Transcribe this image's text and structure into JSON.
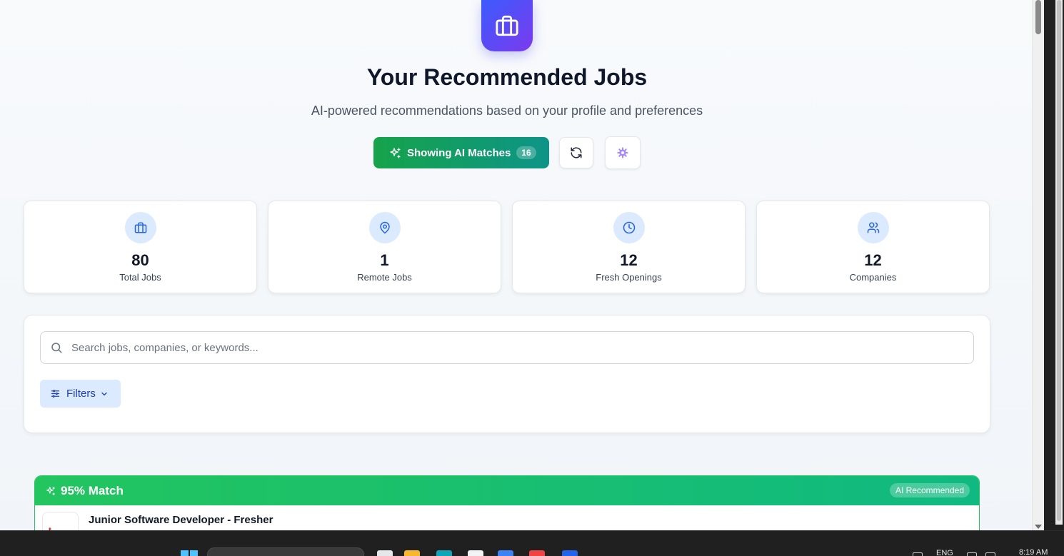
{
  "header": {
    "title": "Your Recommended Jobs",
    "subtitle": "AI-powered recommendations based on your profile and preferences",
    "hero_icon": "briefcase-icon"
  },
  "actions": {
    "ai_matches_label": "Showing AI Matches",
    "ai_matches_count": "16",
    "refresh_icon": "refresh-icon",
    "settings_icon": "gear-icon"
  },
  "stats": [
    {
      "value": "80",
      "label": "Total Jobs",
      "icon": "briefcase-icon"
    },
    {
      "value": "1",
      "label": "Remote Jobs",
      "icon": "map-pin-icon"
    },
    {
      "value": "12",
      "label": "Fresh Openings",
      "icon": "clock-icon"
    },
    {
      "value": "12",
      "label": "Companies",
      "icon": "users-icon"
    }
  ],
  "search": {
    "placeholder": "Search jobs, companies, or keywords...",
    "filters_label": "Filters"
  },
  "jobs": [
    {
      "match": "95% Match",
      "badge": "AI Recommended",
      "title": "Junior Software Developer - Fresher"
    }
  ],
  "taskbar": {
    "language": "ENG",
    "time": "8:19 AM"
  },
  "colors": {
    "accent_blue": "#2563eb",
    "ai_green": "#16a34a",
    "teal": "#0d9488",
    "hero_gradient_start": "#3b5bfd",
    "hero_gradient_end": "#7c3aed"
  }
}
